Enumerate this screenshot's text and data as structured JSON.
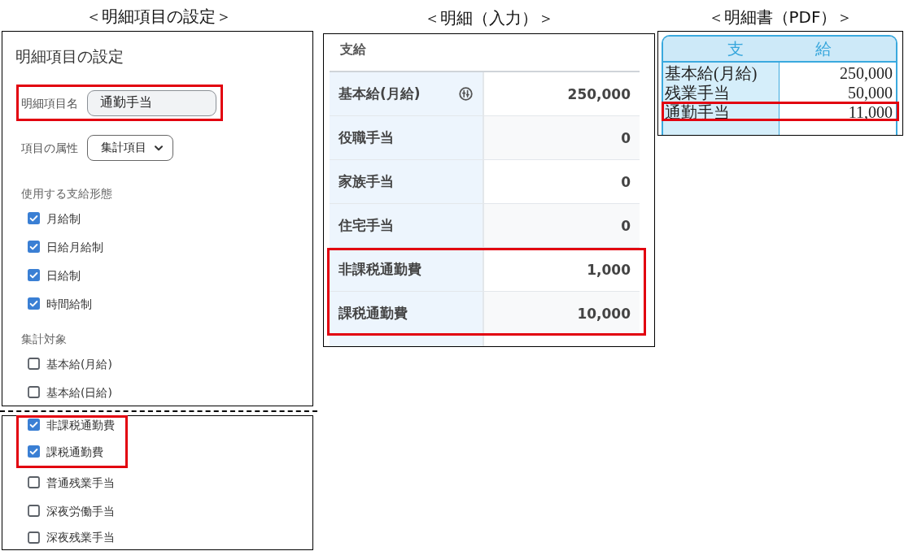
{
  "settings": {
    "caption": "＜明細項目の設定＞",
    "title": "明細項目の設定",
    "name_field": {
      "label": "明細項目名",
      "value": "通勤手当",
      "highlighted": true
    },
    "attribute_field": {
      "label": "項目の属性",
      "value": "集計項目"
    },
    "payment_types": {
      "heading": "使用する支給形態",
      "items": [
        {
          "label": "月給制",
          "checked": true
        },
        {
          "label": "日給月給制",
          "checked": true
        },
        {
          "label": "日給制",
          "checked": true
        },
        {
          "label": "時間給制",
          "checked": true
        }
      ]
    },
    "aggregation": {
      "heading": "集計対象",
      "items": [
        {
          "label": "基本給(月給)",
          "checked": false,
          "highlighted": false
        },
        {
          "label": "基本給(日給)",
          "checked": false,
          "highlighted": false
        }
      ],
      "continued_items": [
        {
          "label": "非課税通勤費",
          "checked": true,
          "highlighted": true
        },
        {
          "label": "課税通勤費",
          "checked": true,
          "highlighted": true
        },
        {
          "label": "普通残業手当",
          "checked": false,
          "highlighted": false
        },
        {
          "label": "深夜労働手当",
          "checked": false,
          "highlighted": false
        },
        {
          "label": "深夜残業手当",
          "checked": false,
          "highlighted": false
        }
      ]
    }
  },
  "payslip_input": {
    "caption": "＜明細（入力）＞",
    "heading": "支給",
    "rows": [
      {
        "label": "基本給(月給)",
        "value": "250,000",
        "kind": "calculated",
        "highlighted": false
      },
      {
        "label": "役職手当",
        "value": "0",
        "kind": "input",
        "highlighted": false
      },
      {
        "label": "家族手当",
        "value": "0",
        "kind": "input",
        "highlighted": false
      },
      {
        "label": "住宅手当",
        "value": "0",
        "kind": "input",
        "highlighted": false
      },
      {
        "label": "非課税通勤費",
        "value": "1,000",
        "kind": "input",
        "highlighted": true
      },
      {
        "label": "課税通勤費",
        "value": "10,000",
        "kind": "input",
        "highlighted": true
      }
    ]
  },
  "payslip_pdf": {
    "caption": "＜明細書（PDF）＞",
    "header": "支 給",
    "rows": [
      {
        "label": "基本給(月給)",
        "value": "250,000",
        "highlighted": false
      },
      {
        "label": "残業手当",
        "value": "50,000",
        "highlighted": false
      },
      {
        "label": "通勤手当",
        "value": "11,000",
        "highlighted": true
      }
    ]
  }
}
